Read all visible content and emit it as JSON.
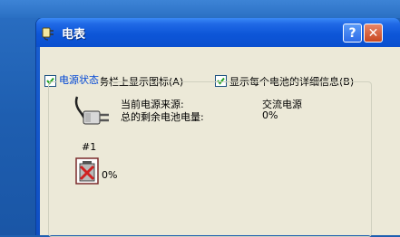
{
  "window": {
    "title": "电表",
    "help_label": "?",
    "close_label": "✕"
  },
  "options": {
    "show_icon_label": "总是在任务栏上显示图标(A)",
    "show_icon_checked": true,
    "show_details_label": "显示每个电池的详细信息(B)",
    "show_details_checked": true
  },
  "power_status": {
    "group_title": "电源状态",
    "source_label": "当前电源来源:",
    "source_value": "交流电源",
    "remaining_label": "总的剩余电池电量:",
    "remaining_value": "0%"
  },
  "battery": {
    "name": "#1",
    "charge": "0%"
  },
  "colors": {
    "titlebar_blue": "#0a4fcf",
    "client_bg": "#ece9d8",
    "group_title_blue": "#0046d5",
    "close_red": "#c9471f"
  }
}
